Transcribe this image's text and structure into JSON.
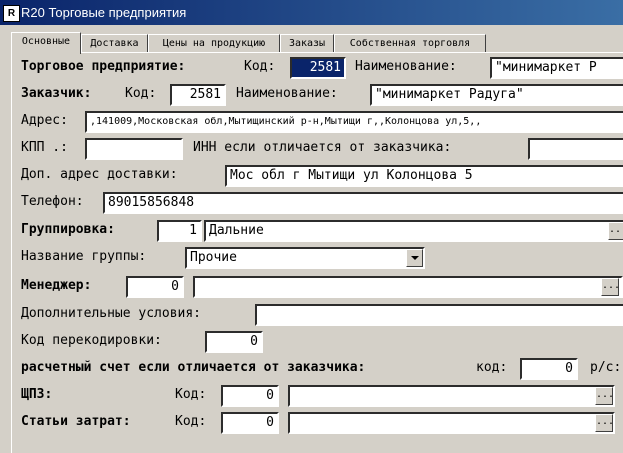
{
  "window": {
    "title": "R20 Торговые предприятия",
    "icon": "app-icon"
  },
  "tabs": [
    "Основные",
    "Доставка",
    "Цены на продукцию",
    "Заказы",
    "Собственная торговля"
  ],
  "trade": {
    "label": "Торговое предприятие:",
    "code_label": "Код:",
    "code": "2581",
    "name_label": "Наименование:",
    "name": "\"минимаркет Р"
  },
  "customer": {
    "label": "Заказчик:",
    "code_label": "Код:",
    "code": "2581",
    "name_label": "Наименование:",
    "name": "\"минимаркет Радуга\""
  },
  "address": {
    "label": "Адрес:",
    "value": ",141009,Московская обл,Мытищинский р-н,Мытищи г,,Колонцова ул,5,,"
  },
  "kpp": {
    "label": "КПП .:",
    "value": ""
  },
  "inn": {
    "label": "ИНН если отличается от заказчика:",
    "value": ""
  },
  "delivery": {
    "label": "Доп. адрес доставки:",
    "value": "Мос обл г Мытищи ул Колонцова 5"
  },
  "phone": {
    "label": "Телефон:",
    "value": "89015856848"
  },
  "grouping": {
    "label": "Группировка:",
    "code": "1",
    "value": "Дальние"
  },
  "group_name": {
    "label": "Название группы:",
    "value": "Прочие"
  },
  "manager": {
    "label": "Менеджер:",
    "code": "0",
    "value": ""
  },
  "conditions": {
    "label": "Дополнительные условия:",
    "value": ""
  },
  "recode": {
    "label": "Код перекодировки:",
    "value": "0"
  },
  "account": {
    "label": "расчетный счет если отличается от заказчика:",
    "code_label": "код:",
    "code": "0",
    "rs_label": "р/с:"
  },
  "cpz": {
    "label": "ЩПЗ:",
    "code_label": "Код:",
    "code": "0",
    "value": ""
  },
  "costs": {
    "label": "Статьи затрат:",
    "code_label": "Код:",
    "code": "0",
    "value": ""
  },
  "ellipsis": "..."
}
